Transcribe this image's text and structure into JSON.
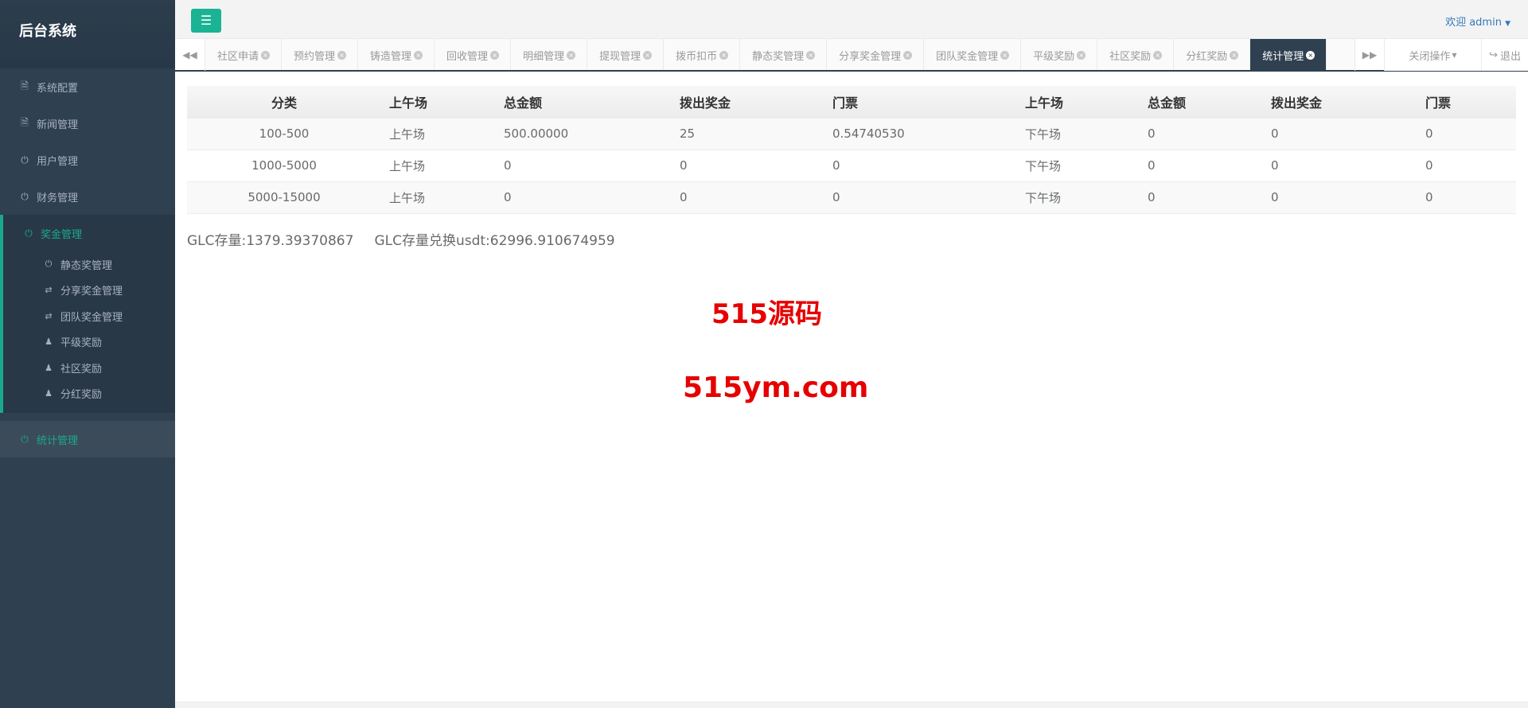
{
  "sidebar": {
    "logo": "后台系统",
    "items_top": [
      {
        "label": "系统配置",
        "icon": "doc-icon"
      },
      {
        "label": "新闻管理",
        "icon": "doc-icon"
      },
      {
        "label": "用户管理",
        "icon": "power-icon"
      },
      {
        "label": "财务管理",
        "icon": "power-icon"
      }
    ],
    "open_item": {
      "label": "奖金管理",
      "icon": "power-icon"
    },
    "submenu": [
      {
        "label": "静态奖管理",
        "icon": "power-icon"
      },
      {
        "label": "分享奖金管理",
        "icon": "shuffle-icon"
      },
      {
        "label": "团队奖金管理",
        "icon": "shuffle-icon"
      },
      {
        "label": "平级奖励",
        "icon": "users-icon"
      },
      {
        "label": "社区奖励",
        "icon": "users-icon"
      },
      {
        "label": "分红奖励",
        "icon": "users-icon"
      }
    ],
    "active_item": {
      "label": "统计管理",
      "icon": "power-icon"
    }
  },
  "topbar": {
    "welcome": "欢迎 admin"
  },
  "tabs": [
    "社区申请",
    "预约管理",
    "铸造管理",
    "回收管理",
    "明细管理",
    "提现管理",
    "拨币扣币",
    "静态奖管理",
    "分享奖金管理",
    "团队奖金管理",
    "平级奖励",
    "社区奖励",
    "分红奖励",
    "统计管理"
  ],
  "active_tab": "统计管理",
  "tab_ops": {
    "close_ops": "关闭操作",
    "exit": "退出"
  },
  "table": {
    "headers": [
      "分类",
      "上午场",
      "总金额",
      "拨出奖金",
      "门票",
      "上午场",
      "总金额",
      "拨出奖金",
      "门票"
    ],
    "rows": [
      [
        "100-500",
        "上午场",
        "500.00000",
        "25",
        "0.54740530",
        "下午场",
        "0",
        "0",
        "0"
      ],
      [
        "1000-5000",
        "上午场",
        "0",
        "0",
        "0",
        "下午场",
        "0",
        "0",
        "0"
      ],
      [
        "5000-15000",
        "上午场",
        "0",
        "0",
        "0",
        "下午场",
        "0",
        "0",
        "0"
      ]
    ]
  },
  "stats": {
    "glc_stock": "GLC存量:1379.39370867",
    "glc_usdt": "GLC存量兑换usdt:62996.910674959"
  },
  "watermark": {
    "line1": "515源码",
    "line2": "515ym.com"
  },
  "colors": {
    "sidebar": "#2f4050",
    "accent": "#1ab394",
    "watermark": "#e60000"
  }
}
